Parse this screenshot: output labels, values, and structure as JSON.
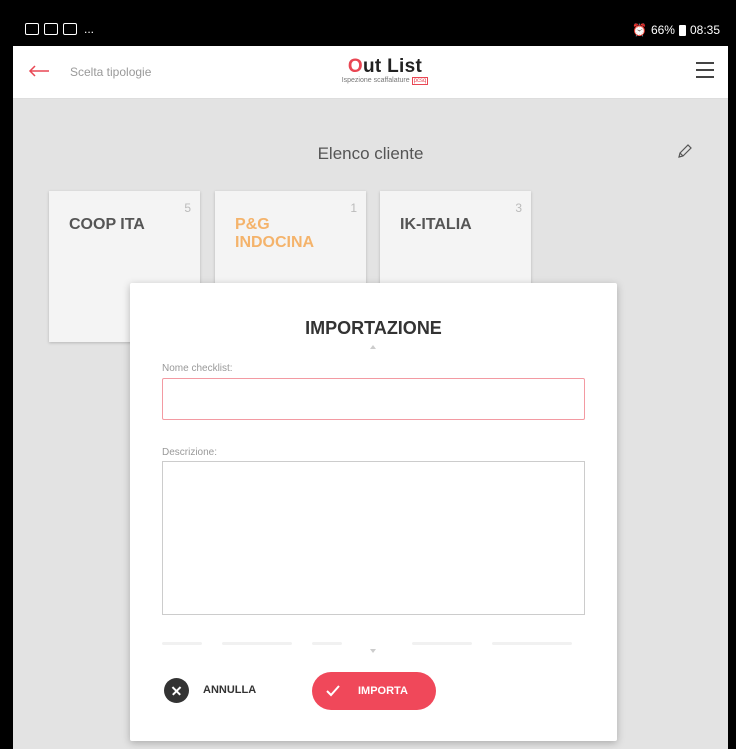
{
  "status_bar": {
    "overflow": "...",
    "battery_text": "66%",
    "time": "08:35"
  },
  "app_bar": {
    "back_label": "Scelta tipologie",
    "logo_o": "O",
    "logo_rest": "ut List",
    "logo_subtitle": "Ispezione scaffalature",
    "logo_tag": "pcsq"
  },
  "section": {
    "title": "Elenco cliente"
  },
  "clients": [
    {
      "name": "COOP ITA",
      "count": "5"
    },
    {
      "name": "P&G INDOCINA",
      "count": "1"
    },
    {
      "name": "IK-ITALIA",
      "count": "3"
    }
  ],
  "dialog": {
    "title": "IMPORTAZIONE",
    "name_label": "Nome checklist:",
    "name_value": "",
    "description_label": "Descrizione:",
    "description_value": "",
    "cancel_label": "ANNULLA",
    "import_label": "IMPORTA"
  },
  "colors": {
    "accent": "#f0485a",
    "active_client": "#f4b36b"
  }
}
